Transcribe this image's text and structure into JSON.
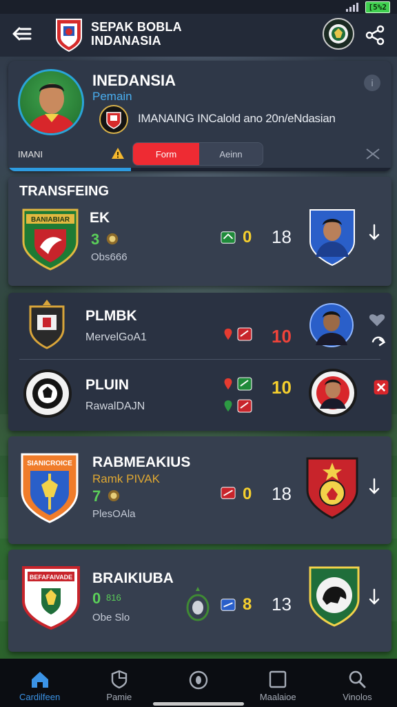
{
  "status_bar": {
    "battery": "[5%2"
  },
  "header": {
    "title": "SEPAK BOBLA INDANASIA"
  },
  "player": {
    "name": "INEDANSIA",
    "role": "Pemain",
    "description": "IMANAING INCalold ano 20n/eNdasian",
    "tab_left": "IMANI",
    "tab_form": "Form",
    "tab_detail": "Aeinn",
    "info": "i",
    "progress_percent": 32
  },
  "sections": [
    {
      "title": "TRANSFEING",
      "teams": [
        {
          "name": "EK",
          "stat": "3",
          "meta": "Obs666",
          "score_a": "0",
          "score_b": "18",
          "banner": "BANIABIAR"
        }
      ]
    },
    {
      "title": "",
      "teams": [
        {
          "name": "PLMBK",
          "city": "MervelGoA1",
          "score_b": "10"
        },
        {
          "name": "PLUIN",
          "city": "RawalDAJN",
          "score_b": "10"
        }
      ]
    },
    {
      "title": "",
      "teams": [
        {
          "name": "RABMEAKIUS",
          "subtitle": "Ramk PIVAK",
          "stat": "7",
          "meta": "PlesOAla",
          "score_a": "0",
          "score_b": "18",
          "banner": "SIANICROICE"
        }
      ]
    },
    {
      "title": "",
      "teams": [
        {
          "name": "BRAIKIUBA",
          "stat": "0",
          "stat_small": "816",
          "meta": "Obe Slo",
          "score_a": "8",
          "score_b": "13",
          "banner": "BEFAFAIVADE"
        }
      ]
    }
  ],
  "bottom_nav": [
    {
      "label": "Cardilfeen",
      "icon": "home-icon",
      "active": true
    },
    {
      "label": "Pamie",
      "icon": "shield-icon",
      "active": false
    },
    {
      "label": "",
      "icon": "ball-icon",
      "active": false
    },
    {
      "label": "Maalaioe",
      "icon": "square-icon",
      "active": false
    },
    {
      "label": "Vinolos",
      "icon": "search-icon",
      "active": false
    }
  ],
  "colors": {
    "accent": "#2d9be0",
    "red": "#ee2b33",
    "score_yellow": "#f5cf2e",
    "stat_green": "#5bcf59"
  }
}
